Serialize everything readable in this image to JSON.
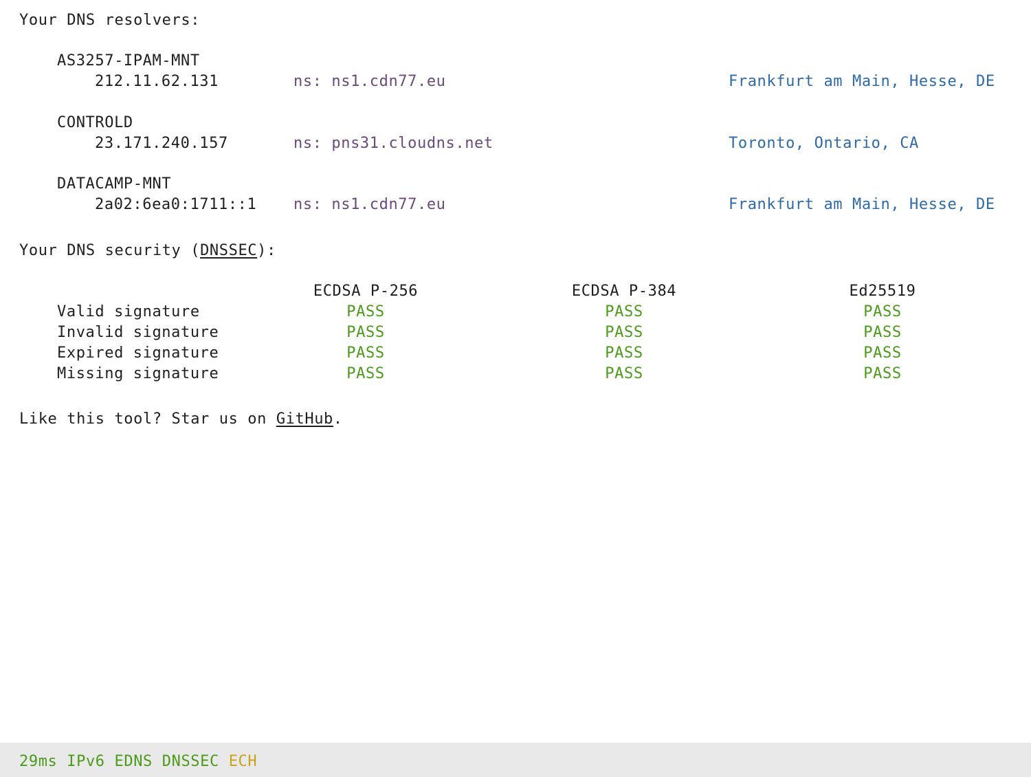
{
  "resolvers": {
    "heading": "Your DNS resolvers:",
    "items": [
      {
        "name": "AS3257-IPAM-MNT",
        "ip": "212.11.62.131",
        "ns": "ns: ns1.cdn77.eu",
        "location": "Frankfurt am Main, Hesse, DE"
      },
      {
        "name": "CONTROLD",
        "ip": "23.171.240.157",
        "ns": "ns: pns31.cloudns.net",
        "location": "Toronto, Ontario, CA"
      },
      {
        "name": "DATACAMP-MNT",
        "ip": "2a02:6ea0:1711::1",
        "ns": "ns: ns1.cdn77.eu",
        "location": "Frankfurt am Main, Hesse, DE"
      }
    ]
  },
  "security": {
    "heading_prefix": "Your DNS security (",
    "heading_link": "DNSSEC",
    "heading_suffix": "):",
    "columns": [
      "ECDSA P-256",
      "ECDSA P-384",
      "Ed25519"
    ],
    "rows": [
      {
        "label": "Valid signature",
        "results": [
          "PASS",
          "PASS",
          "PASS"
        ]
      },
      {
        "label": "Invalid signature",
        "results": [
          "PASS",
          "PASS",
          "PASS"
        ]
      },
      {
        "label": "Expired signature",
        "results": [
          "PASS",
          "PASS",
          "PASS"
        ]
      },
      {
        "label": "Missing signature",
        "results": [
          "PASS",
          "PASS",
          "PASS"
        ]
      }
    ]
  },
  "footer": {
    "prefix": "Like this tool? Star us on ",
    "link": "GitHub",
    "suffix": "."
  },
  "status": {
    "latency": "29ms",
    "ipv6": "IPv6",
    "edns": "EDNS",
    "dnssec": "DNSSEC",
    "ech": "ECH"
  },
  "colors": {
    "nameserver": "#6b4a7a",
    "location": "#2f6aa8",
    "pass": "#4b9a1a",
    "ech": "#c9a21a",
    "status_bg": "#e9e9e9"
  }
}
